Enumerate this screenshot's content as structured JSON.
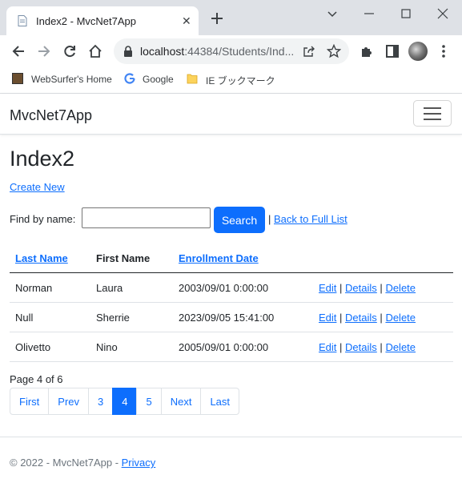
{
  "browser": {
    "tab_title": "Index2 - MvcNet7App",
    "url_host": "localhost",
    "url_path": ":44384/Students/Ind...",
    "bookmarks": [
      {
        "label": "WebSurfer's Home"
      },
      {
        "label": "Google"
      },
      {
        "label": "IE ブックマーク"
      }
    ]
  },
  "navbar": {
    "brand": "MvcNet7App"
  },
  "page": {
    "title": "Index2",
    "create_new": "Create New",
    "find_label": "Find by name:",
    "search_value": "",
    "search_button": "Search",
    "separator": "|",
    "back_link": "Back to Full List"
  },
  "table": {
    "headers": {
      "last_name": "Last Name",
      "first_name": "First Name",
      "enrollment_date": "Enrollment Date"
    },
    "rows": [
      {
        "last": "Norman",
        "first": "Laura",
        "date": "2003/09/01 0:00:00"
      },
      {
        "last": "Null",
        "first": "Sherrie",
        "date": "2023/09/05 15:41:00"
      },
      {
        "last": "Olivetto",
        "first": "Nino",
        "date": "2005/09/01 0:00:00"
      }
    ],
    "actions": {
      "edit": "Edit",
      "details": "Details",
      "delete": "Delete",
      "sep": "|"
    }
  },
  "pagination": {
    "info": "Page 4 of 6",
    "first": "First",
    "prev": "Prev",
    "pages": [
      "3",
      "4",
      "5"
    ],
    "current": "4",
    "next": "Next",
    "last": "Last"
  },
  "footer": {
    "copyright": "© 2022 - MvcNet7App - ",
    "privacy": "Privacy"
  },
  "colors": {
    "primary": "#0d6efd",
    "chrome": "#dee1e6"
  }
}
